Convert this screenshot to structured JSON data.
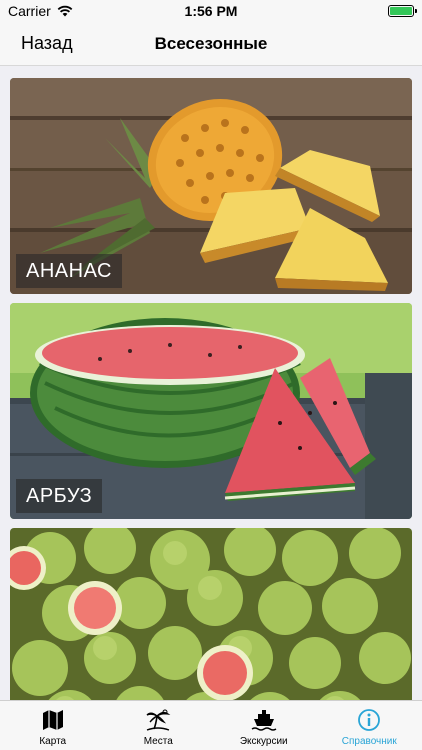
{
  "status_bar": {
    "carrier": "Carrier",
    "time": "1:56 PM",
    "battery_level": 1.0
  },
  "nav": {
    "back_label": "Назад",
    "title": "Всесезонные"
  },
  "items": [
    {
      "label": "АНАНАС",
      "image": "pineapple-photo"
    },
    {
      "label": "АРБУЗ",
      "image": "watermelon-photo"
    },
    {
      "label": "",
      "image": "guava-photo"
    }
  ],
  "tabs": [
    {
      "label": "Карта",
      "icon": "map-icon",
      "active": false
    },
    {
      "label": "Места",
      "icon": "palm-tree-icon",
      "active": false
    },
    {
      "label": "Экскурсии",
      "icon": "ship-icon",
      "active": false
    },
    {
      "label": "Справочник",
      "icon": "info-icon",
      "active": true
    }
  ],
  "colors": {
    "accent": "#2aa5d6",
    "battery": "#34c759"
  }
}
